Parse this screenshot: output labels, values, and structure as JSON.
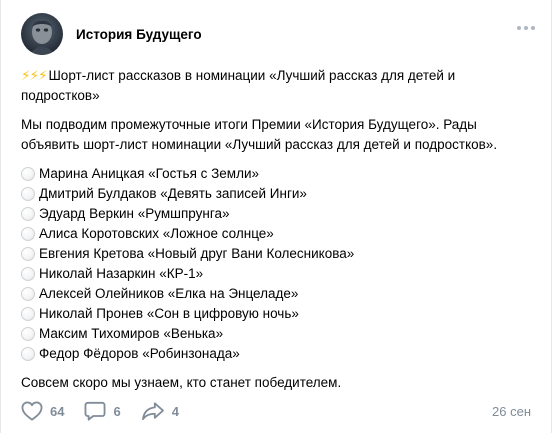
{
  "author": {
    "name": "История Будущего"
  },
  "post": {
    "emoji": "⚡⚡⚡",
    "intro": "Шорт-лист рассказов в номинации «Лучший рассказ для детей и подростков»",
    "paragraph": "Мы подводим промежуточные итоги Премии «История Будущего». Рады объявить шорт-лист номинации «Лучший рассказ для детей и подростков».",
    "nominees": [
      "Марина Аницкая «Гостья с Земли»",
      "Дмитрий Булдаков «Девять записей Инги»",
      "Эдуард Веркин «Румшпрунга»",
      "Алиса Коротовских «Ложное солнце»",
      "Евгения Кретова «Новый друг Вани Колесникова»",
      "Николай Назаркин «КР-1»",
      "Алексей Олейников «Елка на Энцеладе»",
      "Николай Пронев «Сон в цифровую ночь»",
      "Максим Тихомиров «Венька»",
      "Федор Фёдоров «Робинзонада»"
    ],
    "closing": "Совсем скоро мы узнаем, кто станет победителем."
  },
  "footer": {
    "likes": "64",
    "comments": "6",
    "shares": "4",
    "date": "26 сен"
  },
  "icons": {
    "more": "more-horizontal-icon",
    "like": "heart-icon",
    "comment": "comment-icon",
    "share": "share-icon",
    "list_marker": "white-circle-emoji"
  },
  "colors": {
    "muted": "#818c99",
    "bolt": "#f5c518",
    "dots": "#aeb7c2"
  }
}
